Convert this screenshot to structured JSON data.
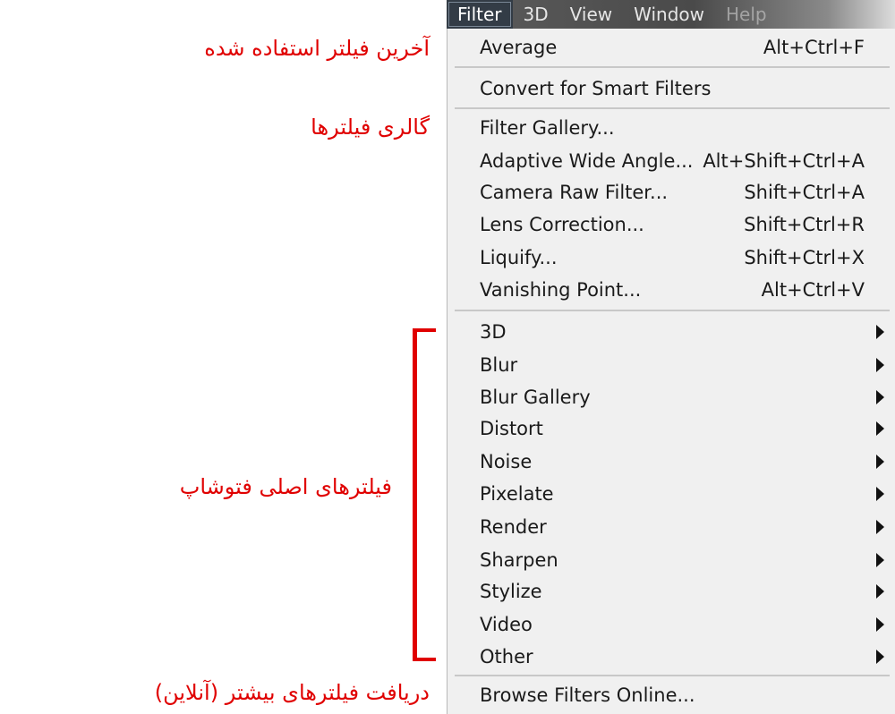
{
  "menubar": {
    "items": [
      "Filter",
      "3D",
      "View",
      "Window",
      "Help"
    ]
  },
  "menu": {
    "last_filter": {
      "label": "Average",
      "shortcut": "Alt+Ctrl+F"
    },
    "convert": {
      "label": "Convert for Smart Filters"
    },
    "gallery": {
      "label": "Filter Gallery..."
    },
    "tools": [
      {
        "label": "Adaptive Wide Angle...",
        "shortcut": "Alt+Shift+Ctrl+A"
      },
      {
        "label": "Camera Raw Filter...",
        "shortcut": "Shift+Ctrl+A"
      },
      {
        "label": "Lens Correction...",
        "shortcut": "Shift+Ctrl+R"
      },
      {
        "label": "Liquify...",
        "shortcut": "Shift+Ctrl+X"
      },
      {
        "label": "Vanishing Point...",
        "shortcut": "Alt+Ctrl+V"
      }
    ],
    "submenus": [
      "3D",
      "Blur",
      "Blur Gallery",
      "Distort",
      "Noise",
      "Pixelate",
      "Render",
      "Sharpen",
      "Stylize",
      "Video",
      "Other"
    ],
    "browse": {
      "label": "Browse Filters Online..."
    }
  },
  "annotations": {
    "last_filter": "آخرین فیلتر استفاده شده",
    "gallery": "گالری فیلترها",
    "main_filters": "فیلترهای اصلی فتوشاپ",
    "online": "دریافت فیلترهای بیشتر (آنلاین)"
  },
  "colors": {
    "annotation": "#e00000",
    "menu_bg": "#f0f0f0",
    "menubar_active": "#333c46"
  }
}
